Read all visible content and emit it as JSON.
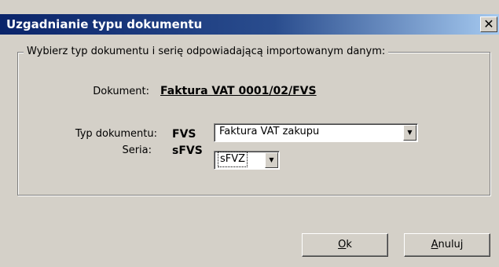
{
  "window": {
    "title": "Uzgadnianie typu dokumentu",
    "close_glyph": "✕"
  },
  "group": {
    "legend": "Wybierz typ dokumentu i serię odpowiadającą importowanym danym:"
  },
  "document": {
    "label": "Dokument:",
    "value": "Faktura VAT 0001/02/FVS"
  },
  "type": {
    "label": "Typ dokumentu:",
    "code": "FVS",
    "selected": "Faktura VAT zakupu"
  },
  "seria": {
    "label": "Seria:",
    "code": "sFVS",
    "selected": "sFVZ"
  },
  "buttons": {
    "ok_accel": "O",
    "ok_rest": "k",
    "cancel_accel": "A",
    "cancel_rest": "nuluj"
  },
  "icons": {
    "dropdown": "▼"
  },
  "colors": {
    "titlebar_start": "#0a246a",
    "titlebar_end": "#a6caf0",
    "face": "#d4d0c8"
  }
}
